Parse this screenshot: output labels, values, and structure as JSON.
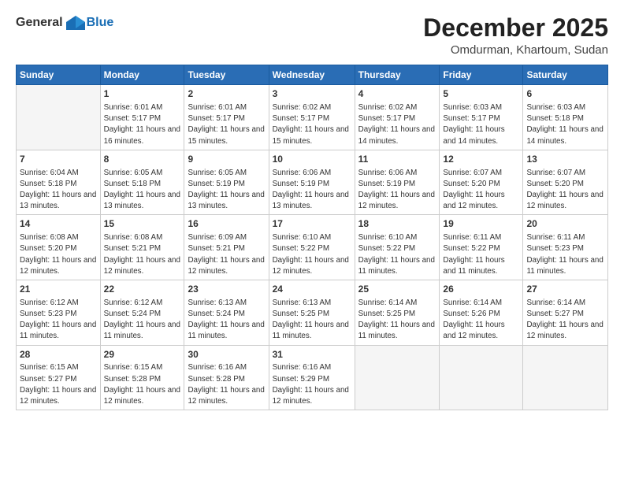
{
  "header": {
    "logo_general": "General",
    "logo_blue": "Blue",
    "month_title": "December 2025",
    "location": "Omdurman, Khartoum, Sudan"
  },
  "weekdays": [
    "Sunday",
    "Monday",
    "Tuesday",
    "Wednesday",
    "Thursday",
    "Friday",
    "Saturday"
  ],
  "weeks": [
    [
      {
        "day": "",
        "empty": true
      },
      {
        "day": "1",
        "sunrise": "6:01 AM",
        "sunset": "5:17 PM",
        "daylight": "11 hours and 16 minutes."
      },
      {
        "day": "2",
        "sunrise": "6:01 AM",
        "sunset": "5:17 PM",
        "daylight": "11 hours and 15 minutes."
      },
      {
        "day": "3",
        "sunrise": "6:02 AM",
        "sunset": "5:17 PM",
        "daylight": "11 hours and 15 minutes."
      },
      {
        "day": "4",
        "sunrise": "6:02 AM",
        "sunset": "5:17 PM",
        "daylight": "11 hours and 14 minutes."
      },
      {
        "day": "5",
        "sunrise": "6:03 AM",
        "sunset": "5:17 PM",
        "daylight": "11 hours and 14 minutes."
      },
      {
        "day": "6",
        "sunrise": "6:03 AM",
        "sunset": "5:18 PM",
        "daylight": "11 hours and 14 minutes."
      }
    ],
    [
      {
        "day": "7",
        "sunrise": "6:04 AM",
        "sunset": "5:18 PM",
        "daylight": "11 hours and 13 minutes."
      },
      {
        "day": "8",
        "sunrise": "6:05 AM",
        "sunset": "5:18 PM",
        "daylight": "11 hours and 13 minutes."
      },
      {
        "day": "9",
        "sunrise": "6:05 AM",
        "sunset": "5:19 PM",
        "daylight": "11 hours and 13 minutes."
      },
      {
        "day": "10",
        "sunrise": "6:06 AM",
        "sunset": "5:19 PM",
        "daylight": "11 hours and 13 minutes."
      },
      {
        "day": "11",
        "sunrise": "6:06 AM",
        "sunset": "5:19 PM",
        "daylight": "11 hours and 12 minutes."
      },
      {
        "day": "12",
        "sunrise": "6:07 AM",
        "sunset": "5:20 PM",
        "daylight": "11 hours and 12 minutes."
      },
      {
        "day": "13",
        "sunrise": "6:07 AM",
        "sunset": "5:20 PM",
        "daylight": "11 hours and 12 minutes."
      }
    ],
    [
      {
        "day": "14",
        "sunrise": "6:08 AM",
        "sunset": "5:20 PM",
        "daylight": "11 hours and 12 minutes."
      },
      {
        "day": "15",
        "sunrise": "6:08 AM",
        "sunset": "5:21 PM",
        "daylight": "11 hours and 12 minutes."
      },
      {
        "day": "16",
        "sunrise": "6:09 AM",
        "sunset": "5:21 PM",
        "daylight": "11 hours and 12 minutes."
      },
      {
        "day": "17",
        "sunrise": "6:10 AM",
        "sunset": "5:22 PM",
        "daylight": "11 hours and 12 minutes."
      },
      {
        "day": "18",
        "sunrise": "6:10 AM",
        "sunset": "5:22 PM",
        "daylight": "11 hours and 11 minutes."
      },
      {
        "day": "19",
        "sunrise": "6:11 AM",
        "sunset": "5:22 PM",
        "daylight": "11 hours and 11 minutes."
      },
      {
        "day": "20",
        "sunrise": "6:11 AM",
        "sunset": "5:23 PM",
        "daylight": "11 hours and 11 minutes."
      }
    ],
    [
      {
        "day": "21",
        "sunrise": "6:12 AM",
        "sunset": "5:23 PM",
        "daylight": "11 hours and 11 minutes."
      },
      {
        "day": "22",
        "sunrise": "6:12 AM",
        "sunset": "5:24 PM",
        "daylight": "11 hours and 11 minutes."
      },
      {
        "day": "23",
        "sunrise": "6:13 AM",
        "sunset": "5:24 PM",
        "daylight": "11 hours and 11 minutes."
      },
      {
        "day": "24",
        "sunrise": "6:13 AM",
        "sunset": "5:25 PM",
        "daylight": "11 hours and 11 minutes."
      },
      {
        "day": "25",
        "sunrise": "6:14 AM",
        "sunset": "5:25 PM",
        "daylight": "11 hours and 11 minutes."
      },
      {
        "day": "26",
        "sunrise": "6:14 AM",
        "sunset": "5:26 PM",
        "daylight": "11 hours and 12 minutes."
      },
      {
        "day": "27",
        "sunrise": "6:14 AM",
        "sunset": "5:27 PM",
        "daylight": "11 hours and 12 minutes."
      }
    ],
    [
      {
        "day": "28",
        "sunrise": "6:15 AM",
        "sunset": "5:27 PM",
        "daylight": "11 hours and 12 minutes."
      },
      {
        "day": "29",
        "sunrise": "6:15 AM",
        "sunset": "5:28 PM",
        "daylight": "11 hours and 12 minutes."
      },
      {
        "day": "30",
        "sunrise": "6:16 AM",
        "sunset": "5:28 PM",
        "daylight": "11 hours and 12 minutes."
      },
      {
        "day": "31",
        "sunrise": "6:16 AM",
        "sunset": "5:29 PM",
        "daylight": "11 hours and 12 minutes."
      },
      {
        "day": "",
        "empty": true
      },
      {
        "day": "",
        "empty": true
      },
      {
        "day": "",
        "empty": true
      }
    ]
  ]
}
